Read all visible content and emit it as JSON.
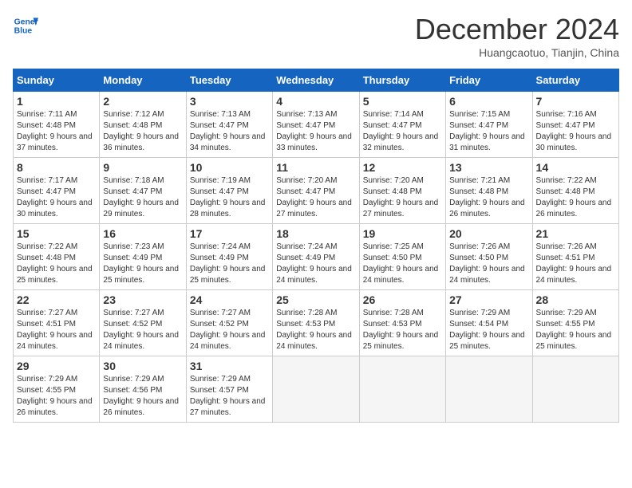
{
  "header": {
    "logo_line1": "General",
    "logo_line2": "Blue",
    "month": "December 2024",
    "location": "Huangcaotuo, Tianjin, China"
  },
  "days_of_week": [
    "Sunday",
    "Monday",
    "Tuesday",
    "Wednesday",
    "Thursday",
    "Friday",
    "Saturday"
  ],
  "weeks": [
    [
      {
        "day": "1",
        "sunrise": "7:11 AM",
        "sunset": "4:48 PM",
        "daylight": "9 hours and 37 minutes."
      },
      {
        "day": "2",
        "sunrise": "7:12 AM",
        "sunset": "4:48 PM",
        "daylight": "9 hours and 36 minutes."
      },
      {
        "day": "3",
        "sunrise": "7:13 AM",
        "sunset": "4:47 PM",
        "daylight": "9 hours and 34 minutes."
      },
      {
        "day": "4",
        "sunrise": "7:13 AM",
        "sunset": "4:47 PM",
        "daylight": "9 hours and 33 minutes."
      },
      {
        "day": "5",
        "sunrise": "7:14 AM",
        "sunset": "4:47 PM",
        "daylight": "9 hours and 32 minutes."
      },
      {
        "day": "6",
        "sunrise": "7:15 AM",
        "sunset": "4:47 PM",
        "daylight": "9 hours and 31 minutes."
      },
      {
        "day": "7",
        "sunrise": "7:16 AM",
        "sunset": "4:47 PM",
        "daylight": "9 hours and 30 minutes."
      }
    ],
    [
      {
        "day": "8",
        "sunrise": "7:17 AM",
        "sunset": "4:47 PM",
        "daylight": "9 hours and 30 minutes."
      },
      {
        "day": "9",
        "sunrise": "7:18 AM",
        "sunset": "4:47 PM",
        "daylight": "9 hours and 29 minutes."
      },
      {
        "day": "10",
        "sunrise": "7:19 AM",
        "sunset": "4:47 PM",
        "daylight": "9 hours and 28 minutes."
      },
      {
        "day": "11",
        "sunrise": "7:20 AM",
        "sunset": "4:47 PM",
        "daylight": "9 hours and 27 minutes."
      },
      {
        "day": "12",
        "sunrise": "7:20 AM",
        "sunset": "4:48 PM",
        "daylight": "9 hours and 27 minutes."
      },
      {
        "day": "13",
        "sunrise": "7:21 AM",
        "sunset": "4:48 PM",
        "daylight": "9 hours and 26 minutes."
      },
      {
        "day": "14",
        "sunrise": "7:22 AM",
        "sunset": "4:48 PM",
        "daylight": "9 hours and 26 minutes."
      }
    ],
    [
      {
        "day": "15",
        "sunrise": "7:22 AM",
        "sunset": "4:48 PM",
        "daylight": "9 hours and 25 minutes."
      },
      {
        "day": "16",
        "sunrise": "7:23 AM",
        "sunset": "4:49 PM",
        "daylight": "9 hours and 25 minutes."
      },
      {
        "day": "17",
        "sunrise": "7:24 AM",
        "sunset": "4:49 PM",
        "daylight": "9 hours and 25 minutes."
      },
      {
        "day": "18",
        "sunrise": "7:24 AM",
        "sunset": "4:49 PM",
        "daylight": "9 hours and 24 minutes."
      },
      {
        "day": "19",
        "sunrise": "7:25 AM",
        "sunset": "4:50 PM",
        "daylight": "9 hours and 24 minutes."
      },
      {
        "day": "20",
        "sunrise": "7:26 AM",
        "sunset": "4:50 PM",
        "daylight": "9 hours and 24 minutes."
      },
      {
        "day": "21",
        "sunrise": "7:26 AM",
        "sunset": "4:51 PM",
        "daylight": "9 hours and 24 minutes."
      }
    ],
    [
      {
        "day": "22",
        "sunrise": "7:27 AM",
        "sunset": "4:51 PM",
        "daylight": "9 hours and 24 minutes."
      },
      {
        "day": "23",
        "sunrise": "7:27 AM",
        "sunset": "4:52 PM",
        "daylight": "9 hours and 24 minutes."
      },
      {
        "day": "24",
        "sunrise": "7:27 AM",
        "sunset": "4:52 PM",
        "daylight": "9 hours and 24 minutes."
      },
      {
        "day": "25",
        "sunrise": "7:28 AM",
        "sunset": "4:53 PM",
        "daylight": "9 hours and 24 minutes."
      },
      {
        "day": "26",
        "sunrise": "7:28 AM",
        "sunset": "4:53 PM",
        "daylight": "9 hours and 25 minutes."
      },
      {
        "day": "27",
        "sunrise": "7:29 AM",
        "sunset": "4:54 PM",
        "daylight": "9 hours and 25 minutes."
      },
      {
        "day": "28",
        "sunrise": "7:29 AM",
        "sunset": "4:55 PM",
        "daylight": "9 hours and 25 minutes."
      }
    ],
    [
      {
        "day": "29",
        "sunrise": "7:29 AM",
        "sunset": "4:55 PM",
        "daylight": "9 hours and 26 minutes."
      },
      {
        "day": "30",
        "sunrise": "7:29 AM",
        "sunset": "4:56 PM",
        "daylight": "9 hours and 26 minutes."
      },
      {
        "day": "31",
        "sunrise": "7:29 AM",
        "sunset": "4:57 PM",
        "daylight": "9 hours and 27 minutes."
      },
      null,
      null,
      null,
      null
    ]
  ]
}
